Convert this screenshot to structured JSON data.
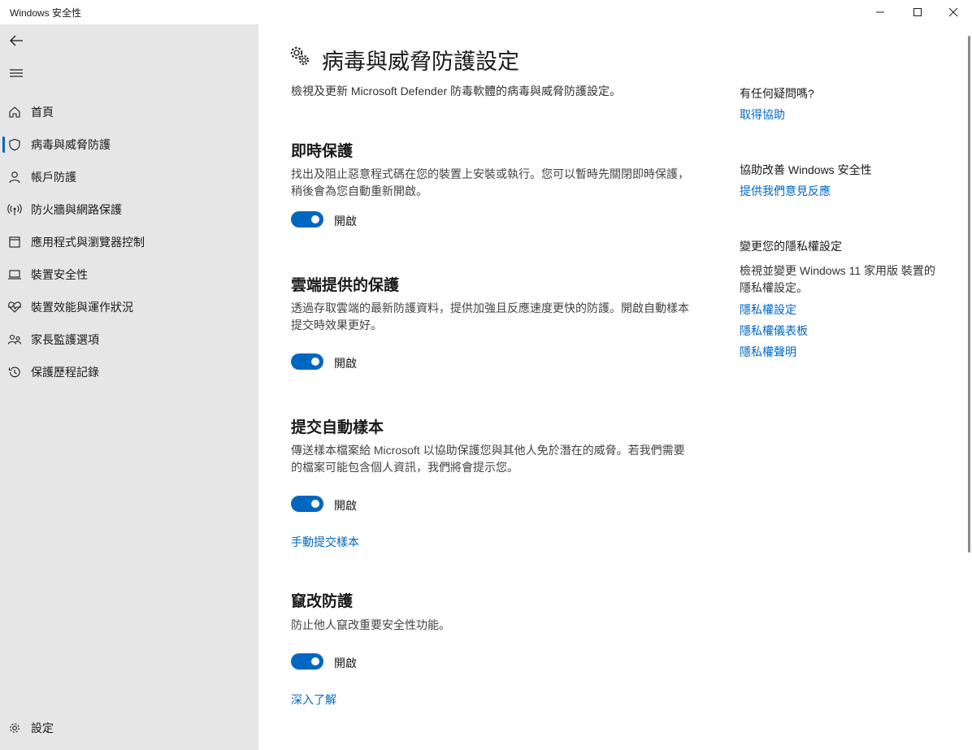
{
  "window": {
    "title": "Windows 安全性"
  },
  "sidebar": {
    "items": [
      {
        "label": "首頁",
        "icon": "home-icon"
      },
      {
        "label": "病毒與威脅防護",
        "icon": "shield-icon"
      },
      {
        "label": "帳戶防護",
        "icon": "person-icon"
      },
      {
        "label": "防火牆與網路保護",
        "icon": "wifi-antenna-icon"
      },
      {
        "label": "應用程式與瀏覽器控制",
        "icon": "app-window-icon"
      },
      {
        "label": "裝置安全性",
        "icon": "laptop-icon"
      },
      {
        "label": "裝置效能與運作狀況",
        "icon": "heart-pulse-icon"
      },
      {
        "label": "家長監護選項",
        "icon": "family-icon"
      },
      {
        "label": "保護歷程記錄",
        "icon": "history-icon"
      }
    ],
    "settings_label": "設定",
    "active_index": 1
  },
  "main": {
    "title": "病毒與威脅防護設定",
    "description": "檢視及更新 Microsoft Defender 防毒軟體的病毒與威脅防護設定。",
    "sections": [
      {
        "title": "即時保護",
        "description": "找出及阻止惡意程式碼在您的裝置上安裝或執行。您可以暫時先關閉即時保護，稍後會為您自動重新開啟。",
        "toggle_label": "開啟",
        "toggle_on": true
      },
      {
        "title": "雲端提供的保護",
        "description": "透過存取雲端的最新防護資料，提供加強且反應速度更快的防護。開啟自動樣本提交時效果更好。",
        "toggle_label": "開啟",
        "toggle_on": true
      },
      {
        "title": "提交自動樣本",
        "description": "傳送樣本檔案給 Microsoft 以協助保護您與其他人免於潛在的威脅。若我們需要的檔案可能包含個人資訊，我們將會提示您。",
        "toggle_label": "開啟",
        "toggle_on": true,
        "link": "手動提交樣本"
      },
      {
        "title": "竄改防護",
        "description": "防止他人竄改重要安全性功能。",
        "toggle_label": "開啟",
        "toggle_on": true,
        "link": "深入了解"
      }
    ]
  },
  "right_panel": {
    "help_heading": "有任何疑問嗎?",
    "help_link": "取得協助",
    "improve_heading": "協助改善 Windows 安全性",
    "improve_link": "提供我們意見反應",
    "privacy_heading": "變更您的隱私權設定",
    "privacy_text": "檢視並變更 Windows 11 家用版 裝置的隱私權設定。",
    "privacy_links": [
      "隱私權設定",
      "隱私權儀表板",
      "隱私權聲明"
    ]
  },
  "colors": {
    "accent": "#0067c0",
    "sidebar_bg": "#e6e6e6"
  }
}
